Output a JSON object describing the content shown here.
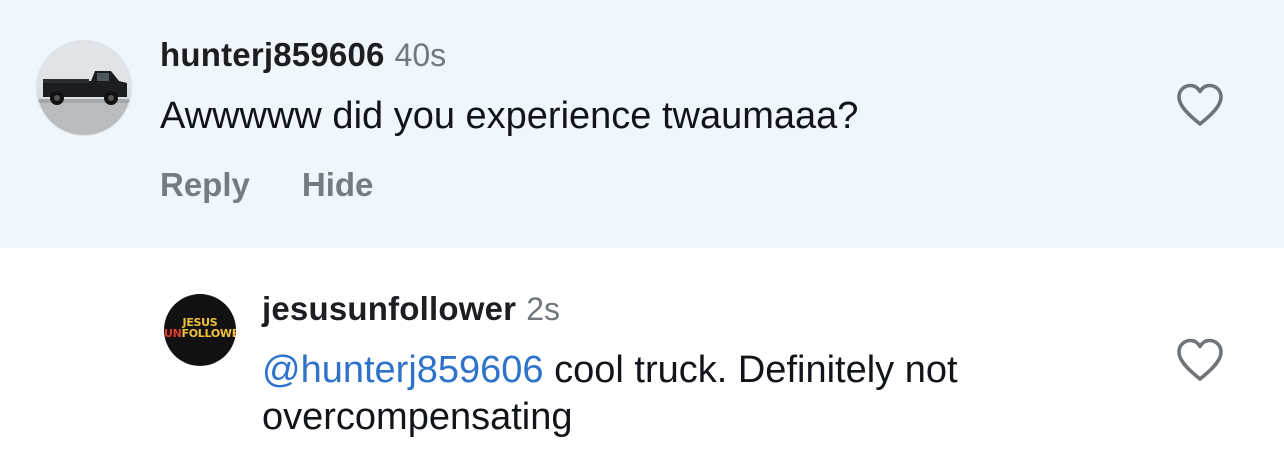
{
  "comments": [
    {
      "username": "hunterj859606",
      "timestamp": "40s",
      "text": "Awwwww did you experience twaumaaa?",
      "actions": {
        "reply": "Reply",
        "hide": "Hide"
      },
      "avatar": "truck-photo",
      "highlighted": true
    },
    {
      "username": "jesusunfollower",
      "timestamp": "2s",
      "mention": "@hunterj859606",
      "text": " cool truck. Definitely not overcompensating",
      "avatar": {
        "line1": "JESUS",
        "line2_prefix": "UN",
        "line2_suffix": "FOLLOWER"
      }
    }
  ],
  "icons": {
    "like": "heart-outline-icon"
  },
  "colors": {
    "highlight_bg": "#eff6fc",
    "mention": "#2e73c9",
    "muted": "#72777d"
  }
}
